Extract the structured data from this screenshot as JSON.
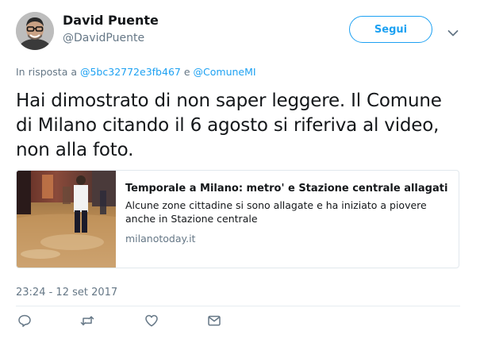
{
  "author": {
    "display_name": "David Puente",
    "handle": "@DavidPuente"
  },
  "follow_button": {
    "label": "Segui"
  },
  "reply_context": {
    "prefix": "In risposta a",
    "user1": "@5bc32772e3fb467",
    "conjunction": "e",
    "user2": "@ComuneMI"
  },
  "tweet": {
    "text": "Hai dimostrato di non saper leggere. Il Comune di Milano citando il 6 agosto si riferiva al video, non alla foto.",
    "timestamp": "23:24 - 12 set 2017"
  },
  "card": {
    "title": "Temporale a Milano: metro' e Stazione centrale allagati",
    "description": "Alcune zone cittadine si sono allagate e ha iniziato a piovere anche in Stazione centrale",
    "domain": "milanotoday.it"
  },
  "actions": {
    "icons": [
      "reply-icon",
      "retweet-icon",
      "like-icon",
      "direct-message-icon"
    ]
  },
  "colors": {
    "accent": "#1da1f2",
    "secondary_text": "#657786",
    "primary_text": "#14171a",
    "border": "#e1e8ed"
  }
}
